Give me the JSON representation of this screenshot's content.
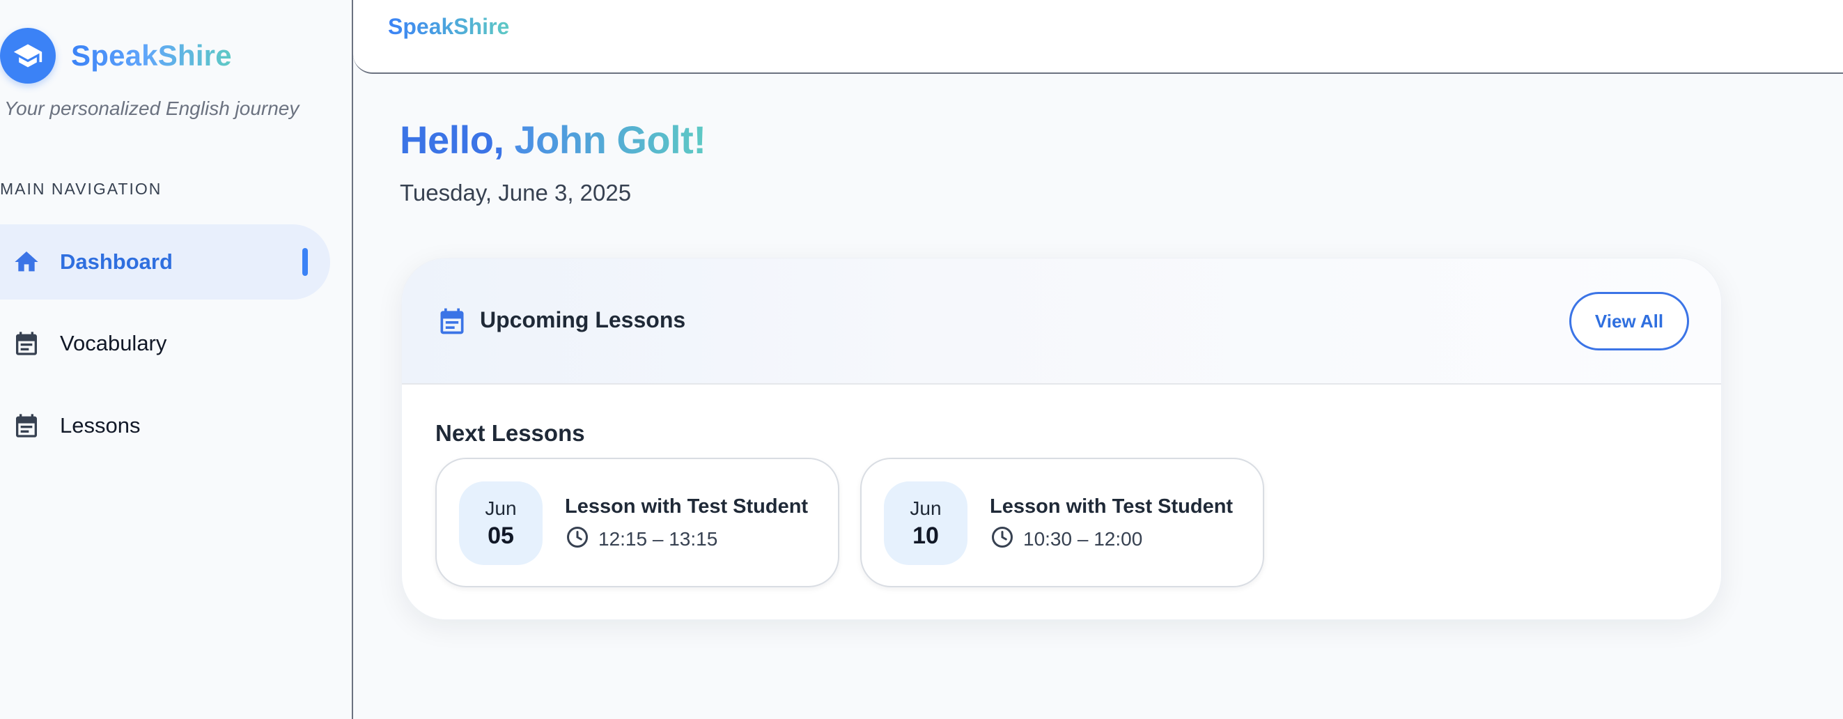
{
  "sidebar": {
    "brand": "SpeakShire",
    "tagline": "Your personalized English journey",
    "nav_heading": "MAIN NAVIGATION",
    "items": [
      {
        "label": "Dashboard",
        "icon": "home-icon",
        "active": true
      },
      {
        "label": "Vocabulary",
        "icon": "calendar-icon",
        "active": false
      },
      {
        "label": "Lessons",
        "icon": "calendar-icon",
        "active": false
      }
    ]
  },
  "topbar": {
    "brand": "SpeakShire"
  },
  "main": {
    "greeting_prefix": "Hello,",
    "user_name": "John Golt!",
    "date": "Tuesday, June 3, 2025",
    "upcoming": {
      "title": "Upcoming Lessons",
      "view_all_label": "View All",
      "section_title": "Next Lessons",
      "lessons": [
        {
          "month": "Jun",
          "day": "05",
          "title": "Lesson with Test Student",
          "time": "12:15 – 13:15"
        },
        {
          "month": "Jun",
          "day": "10",
          "title": "Lesson with Test Student",
          "time": "10:30 – 12:00"
        }
      ]
    }
  },
  "colors": {
    "accent": "#3b74e6",
    "accent_light": "#e8effc",
    "gradient_end": "#5ec9c4"
  }
}
